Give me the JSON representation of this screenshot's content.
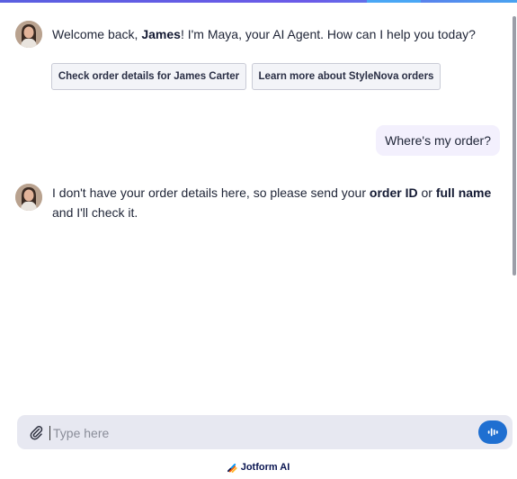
{
  "agent": {
    "name": "Maya",
    "greeting": {
      "prefix": "Welcome back, ",
      "user": "James",
      "suffix": "! I'm Maya, your AI Agent. How can I help you today?"
    },
    "suggestions": [
      {
        "label": "Check order details for James Carter"
      },
      {
        "label": "Learn more about StyleNova orders"
      }
    ],
    "reply": {
      "part1": "I don't have your order details here, so please send your ",
      "bold1": "order ID",
      "part2": " or ",
      "bold2": "full name",
      "part3": " and I'll check it."
    }
  },
  "user_message": "Where's my order?",
  "composer": {
    "placeholder": "Type here",
    "value": ""
  },
  "footer": {
    "brand": "Jotform AI"
  },
  "icons": {
    "attach": "paperclip-icon",
    "voice": "voice-wave-icon",
    "logo": "jotform-logo-icon"
  },
  "colors": {
    "accent": "#1f6fd1",
    "user_bubble": "#f3f0fd",
    "composer_bg": "#e7e8f1"
  }
}
